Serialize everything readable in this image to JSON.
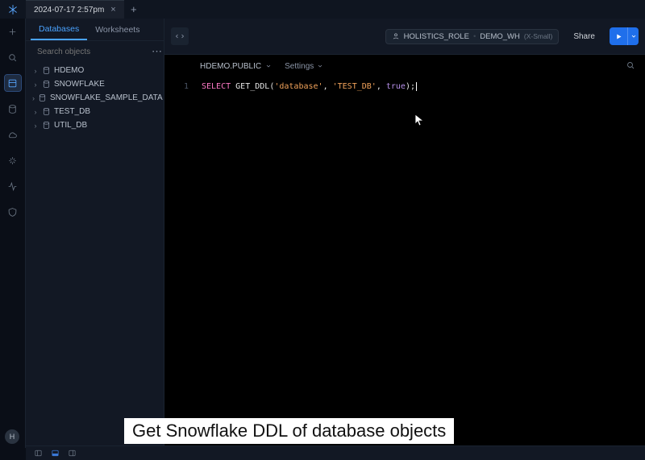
{
  "tab": {
    "label": "2024-07-17 2:57pm"
  },
  "sidebar": {
    "tabs": {
      "databases": "Databases",
      "worksheets": "Worksheets"
    },
    "search_placeholder": "Search objects",
    "tree": [
      {
        "label": "HDEMO"
      },
      {
        "label": "SNOWFLAKE"
      },
      {
        "label": "SNOWFLAKE_SAMPLE_DATA"
      },
      {
        "label": "TEST_DB"
      },
      {
        "label": "UTIL_DB"
      }
    ]
  },
  "header": {
    "role": "HOLISTICS_ROLE",
    "warehouse": "DEMO_WH",
    "wh_size": "(X-Small)",
    "share": "Share"
  },
  "editor": {
    "context": "HDEMO.PUBLIC",
    "settings": "Settings",
    "line_no": "1",
    "sql": {
      "kw": "SELECT",
      "fn": "GET_DDL",
      "arg1": "'database'",
      "comma1": ",",
      "arg2": "'TEST_DB'",
      "comma2": ",",
      "arg3": "true",
      "close": ");"
    }
  },
  "avatar": {
    "initial": "H"
  },
  "caption": "Get Snowflake DDL of database objects"
}
